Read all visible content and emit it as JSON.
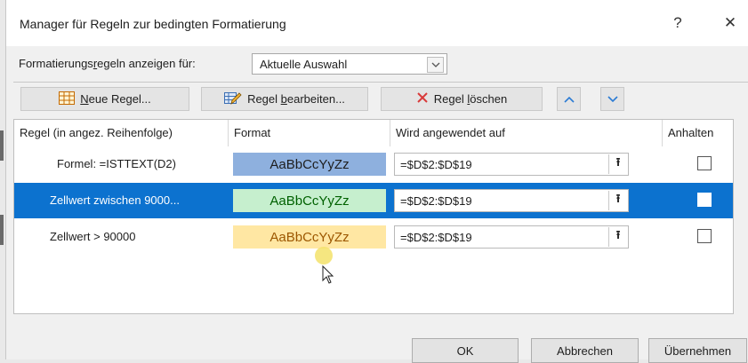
{
  "dialog": {
    "title": "Manager für Regeln zur bedingten Formatierung",
    "help_label": "?",
    "close_label": "✕"
  },
  "show_rules": {
    "label_prefix": "Formatierungs",
    "label_underlined": "r",
    "label_suffix": "egeln anzeigen für:",
    "selected_value": "Aktuelle Auswahl"
  },
  "toolbar": {
    "new_rule": {
      "underlined": "N",
      "rest": "eue Regel..."
    },
    "edit_rule": {
      "prefix": "Regel ",
      "underlined": "b",
      "rest": "earbeiten..."
    },
    "delete_rule": {
      "prefix": "Regel ",
      "underlined": "l",
      "rest": "öschen"
    }
  },
  "table": {
    "headers": [
      "Regel (in angez. Reihenfolge)",
      "Format",
      "Wird angewendet auf",
      "Anhalten"
    ],
    "rows": [
      {
        "rule": "Formel: =ISTTEXT(D2)",
        "preview": "AaBbCcYyZz",
        "applies_to": "=$D$2:$D$19",
        "stop": false,
        "selected": false
      },
      {
        "rule": "Zellwert zwischen 9000...",
        "preview": "AaBbCcYyZz",
        "applies_to": "=$D$2:$D$19",
        "stop": false,
        "selected": true
      },
      {
        "rule": "Zellwert > 90000",
        "preview": "AaBbCcYyZz",
        "applies_to": "=$D$2:$D$19",
        "stop": false,
        "selected": false
      }
    ]
  },
  "buttons": {
    "ok": "OK",
    "cancel": "Abbrechen",
    "apply": "Übernehmen"
  },
  "colors": {
    "selection": "#0c72cf",
    "preview_row1_fill": "#8eb0de",
    "preview_row2_fill": "#c6efce",
    "preview_row2_text": "#006100",
    "preview_row3_fill": "#ffe7a3",
    "preview_row3_text": "#9c5700",
    "delete_icon": "#d93a3a",
    "arrow_icon": "#2a7bd4"
  },
  "icons": {
    "new_rule": "table-grid-icon",
    "edit_rule": "pencil-table-icon",
    "delete_rule": "red-x-icon",
    "move_up": "chevron-up-icon",
    "move_down": "chevron-down-icon",
    "collapse": "collapse-dialog-icon",
    "dropdown": "chevron-down-icon"
  }
}
